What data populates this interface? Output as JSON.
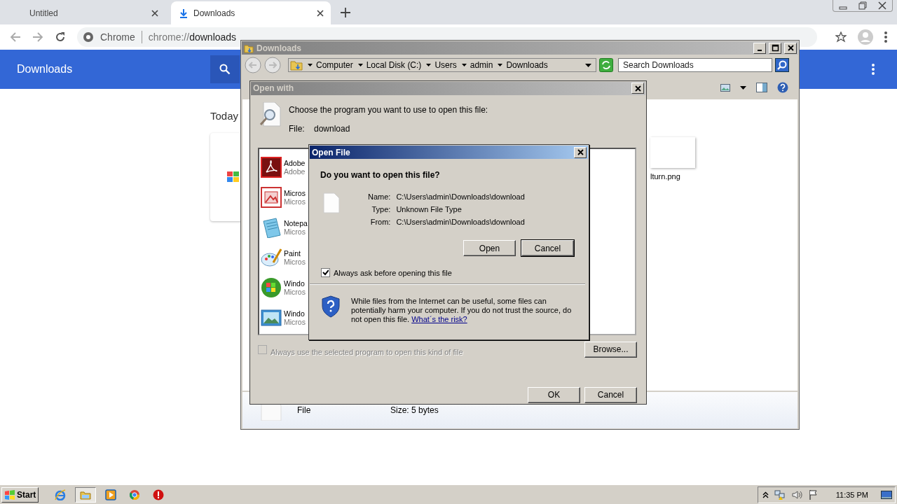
{
  "browser": {
    "tabs": [
      {
        "label": "Untitled",
        "selected": false,
        "kind": "blank"
      },
      {
        "label": "Downloads",
        "selected": true,
        "kind": "downloads"
      }
    ],
    "omnibox": {
      "site": "Chrome",
      "url_scheme": "chrome://",
      "url_path": "downloads"
    },
    "page": {
      "title": "Downloads",
      "section": "Today"
    }
  },
  "explorer": {
    "title": "Downloads",
    "breadcrumb": [
      "Computer",
      "Local Disk (C:)",
      "Users",
      "admin",
      "Downloads"
    ],
    "search": {
      "placeholder": "Search Downloads"
    },
    "thumbnail_label": "lturn.png",
    "details": {
      "type": "File",
      "size": "Size: 5 bytes"
    }
  },
  "open_with": {
    "title": "Open with",
    "prompt": "Choose the program you want to use to open this file:",
    "file_label": "File:",
    "file_name": "download",
    "programs": [
      {
        "name": "Adobe",
        "publisher": "Adobe",
        "kind": "acrobat"
      },
      {
        "name": "Micros",
        "publisher": "Micros",
        "kind": "office"
      },
      {
        "name": "Notepa",
        "publisher": "Micros",
        "kind": "notepad"
      },
      {
        "name": "Paint",
        "publisher": "Micros",
        "kind": "paint"
      },
      {
        "name": "Windo",
        "publisher": "Micros",
        "kind": "windows"
      },
      {
        "name": "Windo",
        "publisher": "Micros",
        "kind": "photo"
      }
    ],
    "always_use": {
      "label": "Always use the selected program to open this kind of file",
      "checked": false,
      "disabled": true
    },
    "buttons": {
      "browse": "Browse...",
      "ok": "OK",
      "cancel": "Cancel"
    }
  },
  "open_file": {
    "title": "Open File",
    "question": "Do you want to open this file?",
    "fields": [
      {
        "label": "Name:",
        "value": "C:\\Users\\admin\\Downloads\\download"
      },
      {
        "label": "Type:",
        "value": "Unknown File Type"
      },
      {
        "label": "From:",
        "value": "C:\\Users\\admin\\Downloads\\download"
      }
    ],
    "buttons": [
      {
        "label": "Open",
        "default": false
      },
      {
        "label": "Cancel",
        "default": true
      }
    ],
    "always_ask": {
      "label": "Always ask before opening this file",
      "checked": true
    },
    "warning": "While files from the Internet can be useful, some files can potentially harm your computer. If you do not trust the source, do not open this file.",
    "risk_link": "What´s the risk?"
  },
  "taskbar": {
    "start": "Start",
    "apps": [
      {
        "kind": "ie",
        "selected": false
      },
      {
        "kind": "explorer",
        "selected": true
      },
      {
        "kind": "media",
        "selected": false
      },
      {
        "kind": "chrome",
        "selected": false
      },
      {
        "kind": "stop",
        "selected": false
      }
    ],
    "clock": "11:35 PM"
  }
}
